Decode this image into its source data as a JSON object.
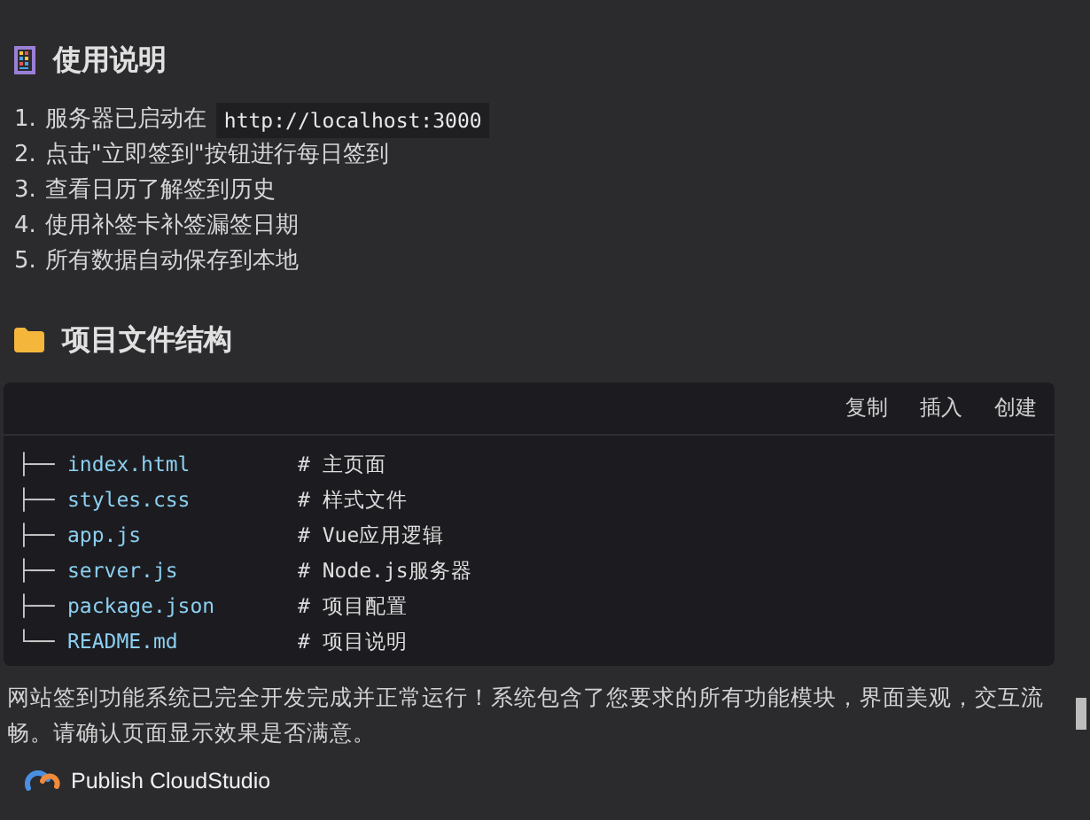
{
  "usage": {
    "title": "使用说明",
    "steps": [
      {
        "number": "1.",
        "text": "服务器已启动在",
        "code": "http://localhost:3000"
      },
      {
        "number": "2.",
        "text": "点击\"立即签到\"按钮进行每日签到"
      },
      {
        "number": "3.",
        "text": "查看日历了解签到历史"
      },
      {
        "number": "4.",
        "text": "使用补签卡补签漏签日期"
      },
      {
        "number": "5.",
        "text": "所有数据自动保存到本地"
      }
    ]
  },
  "structure": {
    "title": "项目文件结构",
    "actions": [
      "复制",
      "插入",
      "创建"
    ],
    "files": [
      {
        "branch": "├──",
        "name": "index.html",
        "comment": "# 主页面"
      },
      {
        "branch": "├──",
        "name": "styles.css",
        "comment": "# 样式文件"
      },
      {
        "branch": "├──",
        "name": "app.js",
        "comment": "# Vue应用逻辑"
      },
      {
        "branch": "├──",
        "name": "server.js",
        "comment": "# Node.js服务器"
      },
      {
        "branch": "├──",
        "name": "package.json",
        "comment": "# 项目配置"
      },
      {
        "branch": "└──",
        "name": "README.md",
        "comment": "# 项目说明"
      }
    ]
  },
  "message": "网站签到功能系统已完全开发完成并正常运行！系统包含了您要求的所有功能模块，界面美观，交互流畅。请确认页面显示效果是否满意。",
  "publish_button": "Publish CloudStudio"
}
